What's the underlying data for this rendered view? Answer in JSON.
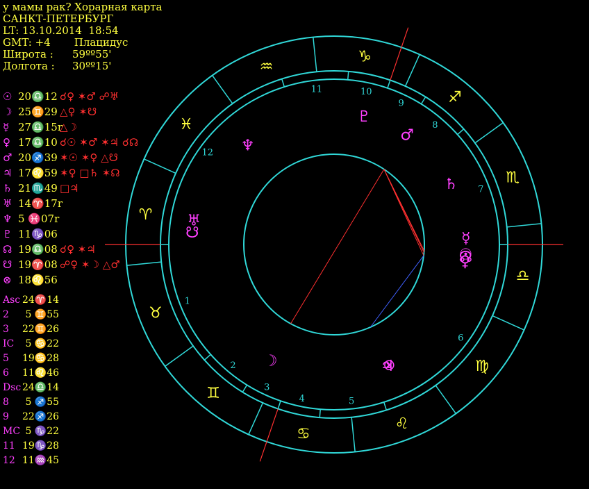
{
  "header": {
    "title": "у мамы рак? Хорарная карта",
    "city": "САНКТ-ПЕТЕРБУРГ",
    "lt": "LT: 13.10.2014  18:54",
    "gmt": "GMT: +4",
    "system": "Плацидус",
    "lat_label": "Широта :",
    "lat_value": "59ºº55'",
    "lon_label": "Долгота :",
    "lon_value": "30ºº15'"
  },
  "planets": [
    {
      "glyph": "☉",
      "pos": "20♎12",
      "asp": "☌♀ ✶♂ ☍♅"
    },
    {
      "glyph": "☽",
      "pos": "25♊29",
      "asp": "△♀ ✶☋"
    },
    {
      "glyph": "☿",
      "pos": "27♎15r",
      "asp": "△☽"
    },
    {
      "glyph": "♀",
      "pos": "17♎10",
      "asp": "☌☉ ✶♂ ✶♃ ☌☊"
    },
    {
      "glyph": "♂",
      "pos": "20♐39",
      "asp": "✶☉ ✶♀ △☋"
    },
    {
      "glyph": "♃",
      "pos": "17♌59",
      "asp": "✶♀ □♄ ✶☊"
    },
    {
      "glyph": "♄",
      "pos": "21♏49",
      "asp": "□♃"
    },
    {
      "glyph": "♅",
      "pos": "14♈17r",
      "asp": ""
    },
    {
      "glyph": "♆",
      "pos": " 5 ♓07r",
      "asp": ""
    },
    {
      "glyph": "♇",
      "pos": "11♑06",
      "asp": ""
    },
    {
      "glyph": "☊",
      "pos": "19♎08",
      "asp": "☌♀ ✶♃"
    },
    {
      "glyph": "☋",
      "pos": "19♈08",
      "asp": "☍♀ ✶☽ △♂"
    },
    {
      "glyph": "⊗",
      "pos": "18♌56",
      "asp": ""
    }
  ],
  "houses": [
    {
      "n": "Asc",
      "pos": "24♈14"
    },
    {
      "n": "2",
      "pos": " 5 ♊55"
    },
    {
      "n": "3",
      "pos": "22♊26"
    },
    {
      "n": "IC",
      "pos": " 5 ♋22"
    },
    {
      "n": "5",
      "pos": "19♋28"
    },
    {
      "n": "6",
      "pos": "11♌46"
    },
    {
      "n": "Dsc",
      "pos": "24♎14"
    },
    {
      "n": "8",
      "pos": " 5 ♐55"
    },
    {
      "n": "9",
      "pos": "22♐26"
    },
    {
      "n": "MC",
      "pos": " 5 ♑22"
    },
    {
      "n": "11",
      "pos": "19♑28"
    },
    {
      "n": "12",
      "pos": "11♒45"
    }
  ],
  "wheel": {
    "signs": [
      "♈",
      "♉",
      "♊",
      "♋",
      "♌",
      "♍",
      "♎",
      "♏",
      "♐",
      "♑",
      "♒",
      "♓"
    ],
    "house_labels": [
      "1",
      "2",
      "3",
      "4",
      "5",
      "6",
      "7",
      "8",
      "9",
      "10",
      "11",
      "12"
    ],
    "chart_planets": [
      "☉",
      "☽",
      "☿",
      "♀",
      "♂",
      "♃",
      "♄",
      "♅",
      "♆",
      "♇",
      "☊",
      "☋",
      "⊗"
    ]
  },
  "colors": {
    "ring": "#30d8d8",
    "text": "#ffff40",
    "planet": "#ff40ff",
    "aspect": "#ff3030",
    "aspect2": "#4060ff"
  }
}
